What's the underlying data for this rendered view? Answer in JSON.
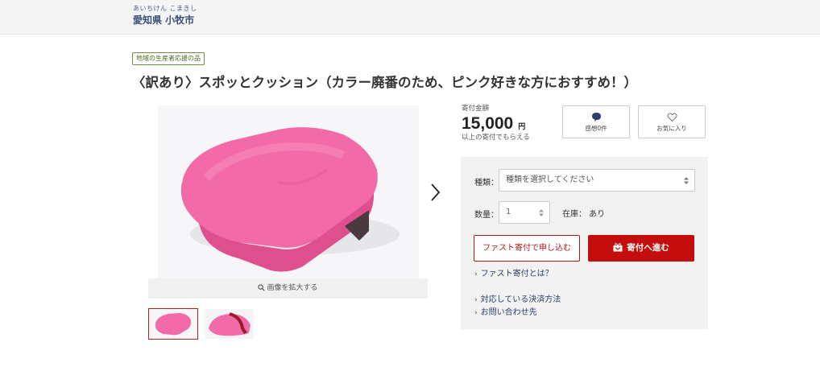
{
  "header": {
    "municipality_kana": "あいちけん こまきし",
    "municipality_name": "愛知県 小牧市"
  },
  "product": {
    "tag": "地域の生産者応援の品",
    "title": "〈訳あり〉スポッとクッション（カラー廃番のため、ピンク好きな方におすすめ！）",
    "zoom_label": "画像を拡大する"
  },
  "donation": {
    "amount_label": "寄付金額",
    "amount_value": "15,000",
    "amount_unit": "円",
    "amount_note": "以上の寄付でもらえる"
  },
  "actions": {
    "review_label": "感想0件",
    "favorite_label": "お気に入り"
  },
  "form": {
    "type_label": "種類：",
    "type_placeholder": "種類を選択してください",
    "quantity_label": "数量：",
    "quantity_value": "1",
    "stock_text": "在庫： あり",
    "fast_button": "ファスト寄付で申し込む",
    "donate_button": "寄付へ進む"
  },
  "links": {
    "fast_info": "ファスト寄付とは？",
    "payment_methods": "対応している決済方法",
    "contact": "お問い合わせ先"
  },
  "icons": {
    "review": "speech-bubble-icon",
    "favorite": "heart-icon",
    "zoom": "magnifier-icon",
    "next": "chevron-right-icon",
    "donate": "gift-box-icon"
  },
  "colors": {
    "accent_red": "#c40d0d",
    "navy_text": "#2a3f6e",
    "cushion_pink": "#f26aa8"
  }
}
